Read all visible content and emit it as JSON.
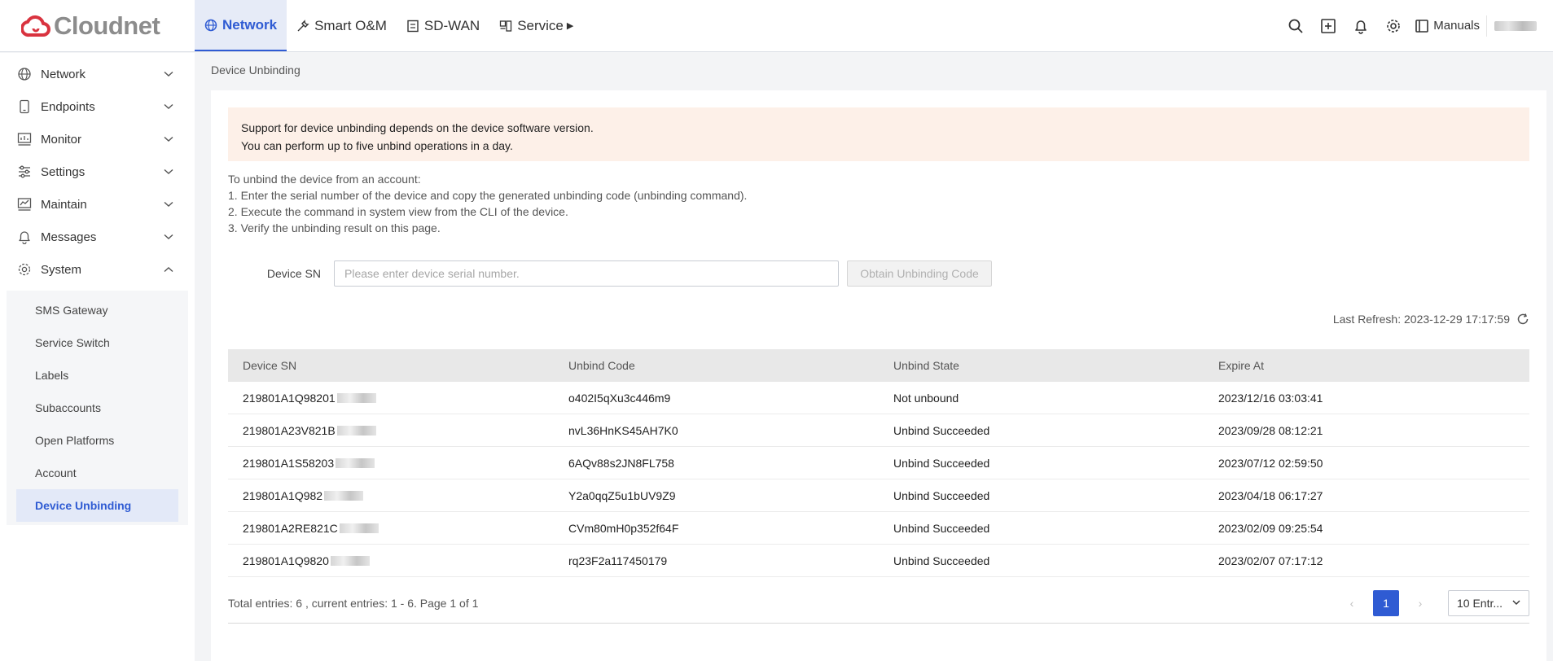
{
  "brand": {
    "name": "Cloudnet",
    "color": "#d9333f"
  },
  "topnav": [
    {
      "label": "Network",
      "icon": "globe-icon",
      "active": true
    },
    {
      "label": "Smart O&M",
      "icon": "wrench-icon",
      "active": false
    },
    {
      "label": "SD-WAN",
      "icon": "sdwan-icon",
      "active": false
    },
    {
      "label": "Service",
      "icon": "service-icon",
      "active": false
    }
  ],
  "toolbar": {
    "manuals_label": "Manuals"
  },
  "sidebar": {
    "items": [
      {
        "label": "Network"
      },
      {
        "label": "Endpoints"
      },
      {
        "label": "Monitor"
      },
      {
        "label": "Settings"
      },
      {
        "label": "Maintain"
      },
      {
        "label": "Messages"
      },
      {
        "label": "System"
      }
    ],
    "system_sub": [
      {
        "label": "SMS Gateway"
      },
      {
        "label": "Service Switch"
      },
      {
        "label": "Labels"
      },
      {
        "label": "Subaccounts"
      },
      {
        "label": "Open Platforms"
      },
      {
        "label": "Account"
      },
      {
        "label": "Device Unbinding"
      }
    ]
  },
  "breadcrumb": "Device Unbinding",
  "notice": {
    "line1": "Support for device unbinding depends on the device software version.",
    "line2": "You can perform up to five unbind operations in a day."
  },
  "instructions": {
    "intro": "To unbind the device from an account:",
    "step1": "1. Enter the serial number of the device and copy the generated unbinding code (unbinding command).",
    "step2": "2. Execute the command in system view from the CLI of the device.",
    "step3": "3. Verify the unbinding result on this page."
  },
  "form": {
    "sn_label": "Device SN",
    "sn_placeholder": "Please enter device serial number.",
    "obtain_button": "Obtain Unbinding Code"
  },
  "refresh": {
    "text": "Last Refresh: 2023-12-29 17:17:59"
  },
  "table": {
    "headers": [
      "Device SN",
      "Unbind Code",
      "Unbind State",
      "Expire At"
    ],
    "rows": [
      {
        "sn": "219801A1Q98201",
        "code": "o402I5qXu3c446m9",
        "state": "Not unbound",
        "expire": "2023/12/16 03:03:41"
      },
      {
        "sn": "219801A23V821B",
        "code": "nvL36HnKS45AH7K0",
        "state": "Unbind Succeeded",
        "expire": "2023/09/28 08:12:21"
      },
      {
        "sn": "219801A1S58203",
        "code": "6AQv88s2JN8FL758",
        "state": "Unbind Succeeded",
        "expire": "2023/07/12 02:59:50"
      },
      {
        "sn": "219801A1Q982",
        "code": "Y2a0qqZ5u1bUV9Z9",
        "state": "Unbind Succeeded",
        "expire": "2023/04/18 06:17:27"
      },
      {
        "sn": "219801A2RE821C",
        "code": "CVm80mH0p352f64F",
        "state": "Unbind Succeeded",
        "expire": "2023/02/09 09:25:54"
      },
      {
        "sn": "219801A1Q9820",
        "code": "rq23F2a117450179",
        "state": "Unbind Succeeded",
        "expire": "2023/02/07 07:17:12"
      }
    ]
  },
  "pagination": {
    "total_text": "Total entries: 6 , current entries: 1 - 6. Page 1 of 1",
    "current_page": "1",
    "page_size": "10 Entr..."
  }
}
